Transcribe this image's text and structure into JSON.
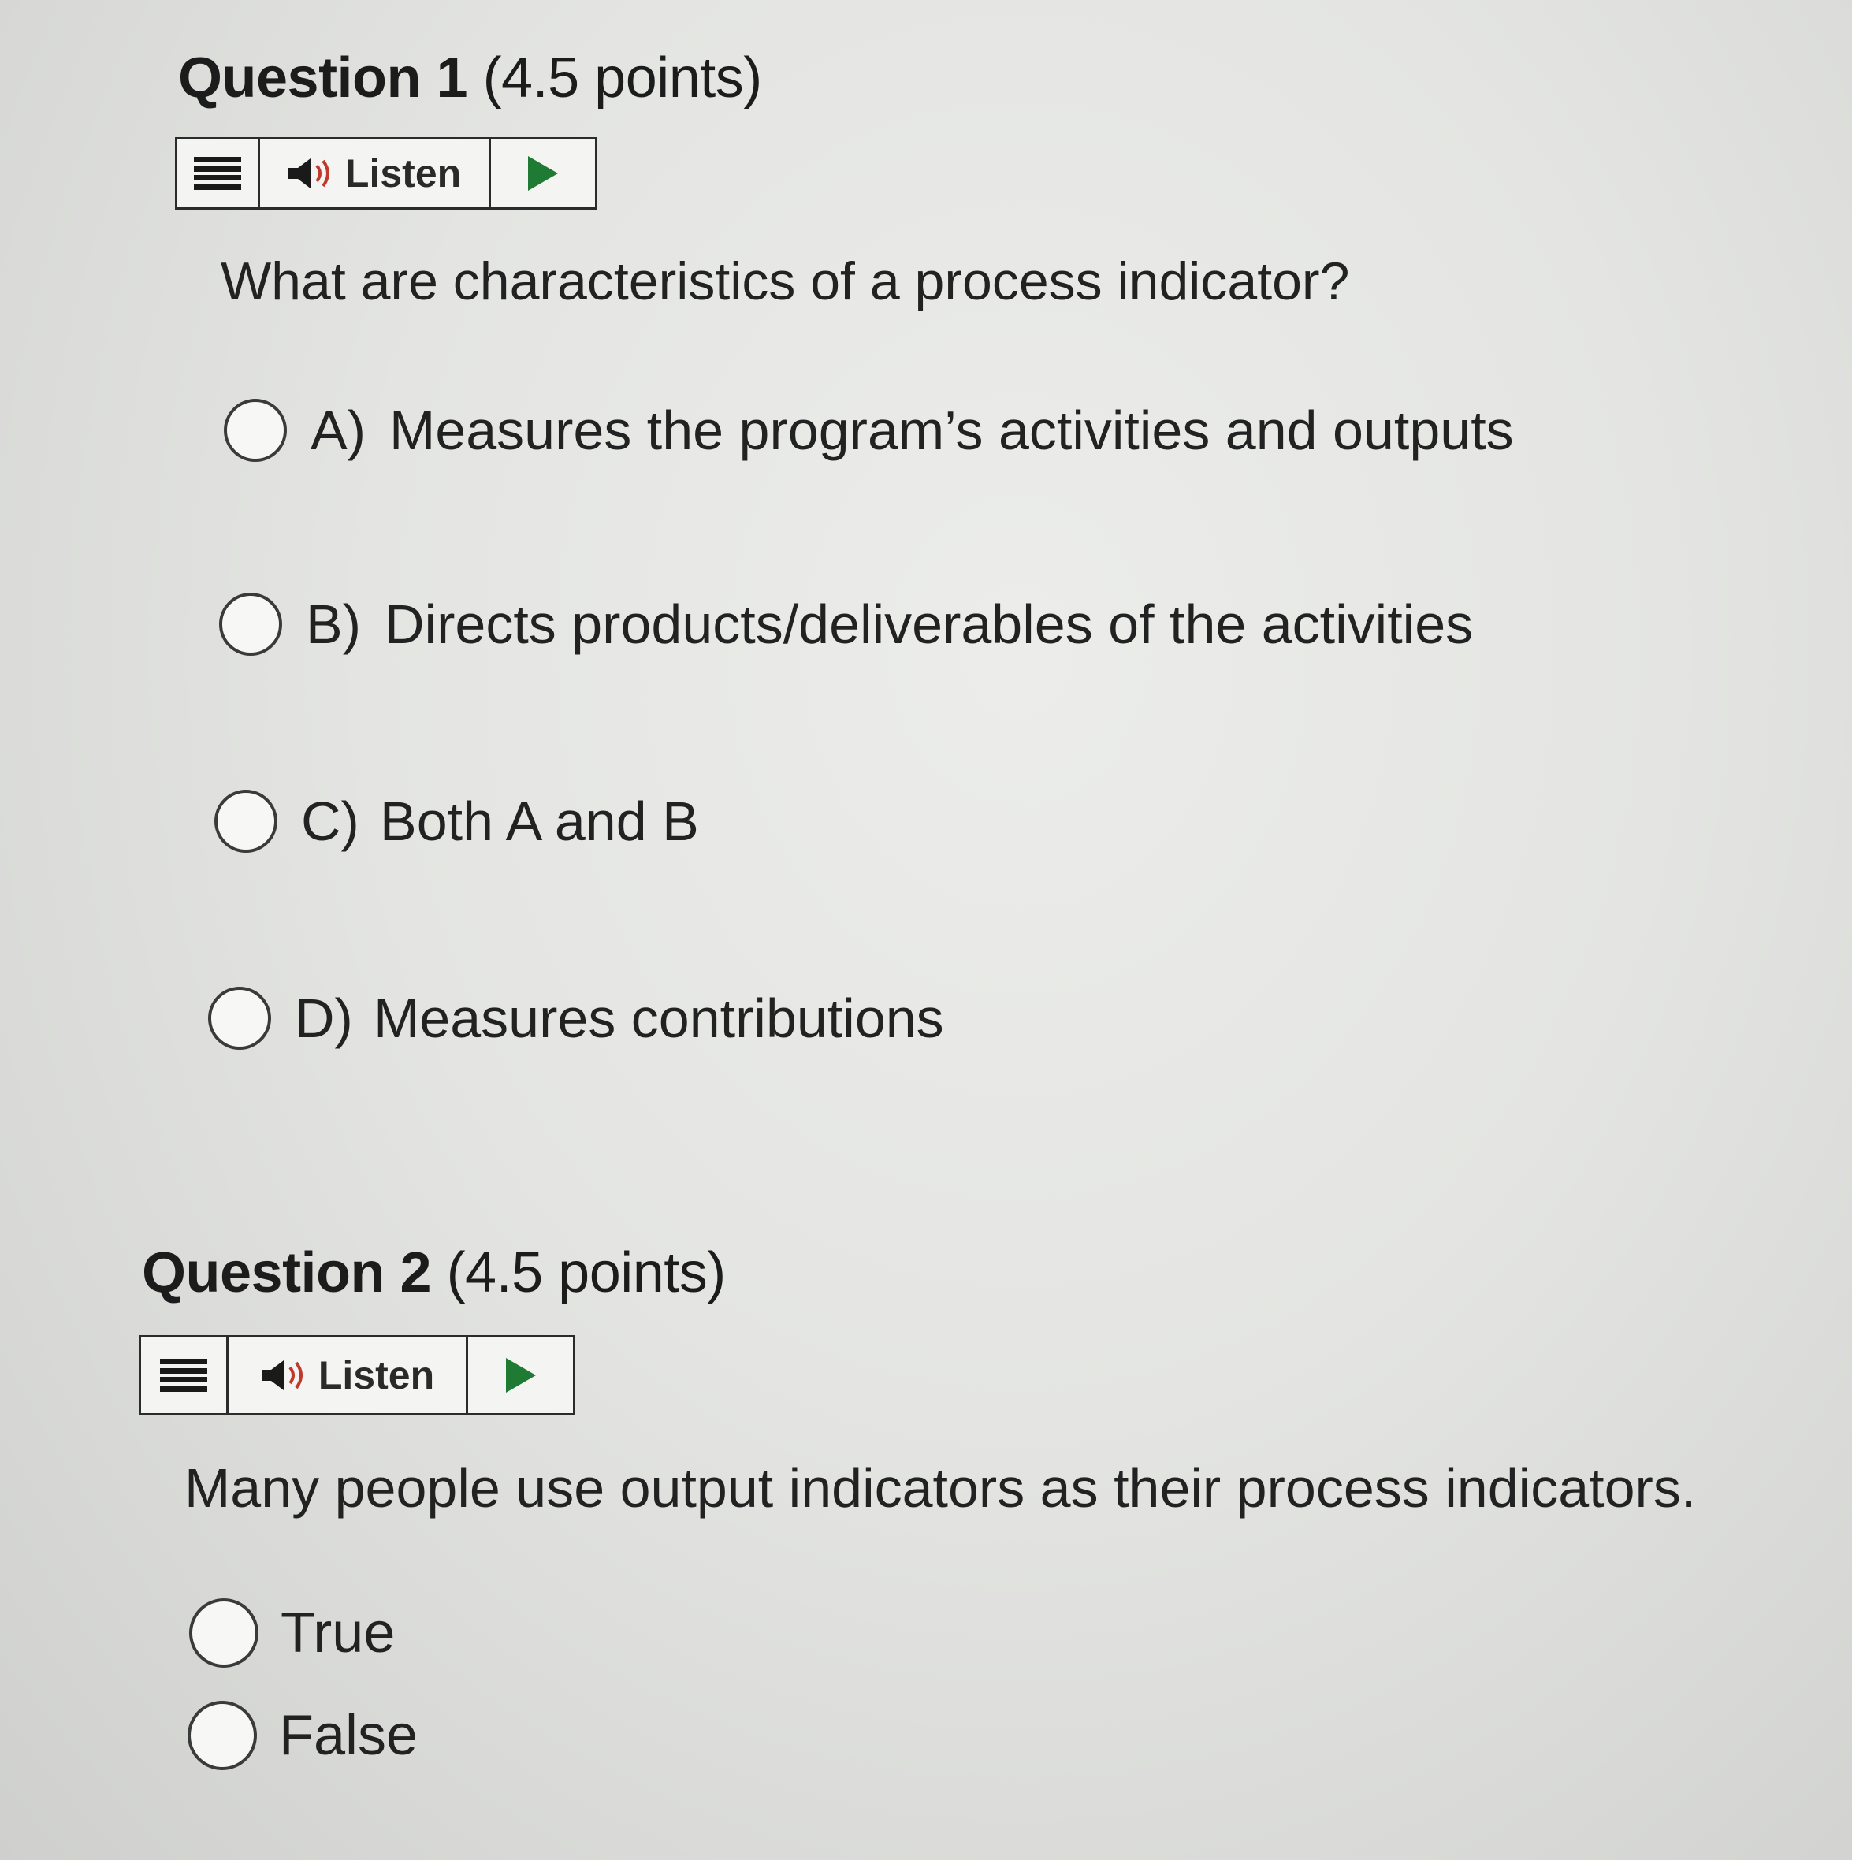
{
  "questions": [
    {
      "number_label": "Question 1",
      "points_label": "(4.5 points)",
      "listen_label": "Listen",
      "prompt": "What are characteristics of a process indicator?",
      "options": [
        {
          "letter": "A)",
          "text": "Measures the program’s activities and outputs"
        },
        {
          "letter": "B)",
          "text": "Directs products/deliverables of the activities"
        },
        {
          "letter": "C)",
          "text": "Both A and B"
        },
        {
          "letter": "D)",
          "text": "Measures contributions"
        }
      ]
    },
    {
      "number_label": "Question 2",
      "points_label": "(4.5 points)",
      "listen_label": "Listen",
      "prompt": "Many people use output indicators as their process indicators.",
      "options": [
        {
          "text": "True"
        },
        {
          "text": "False"
        }
      ]
    }
  ],
  "colors": {
    "play": "#1f7a33",
    "speaker_wave": "#c0392b"
  }
}
